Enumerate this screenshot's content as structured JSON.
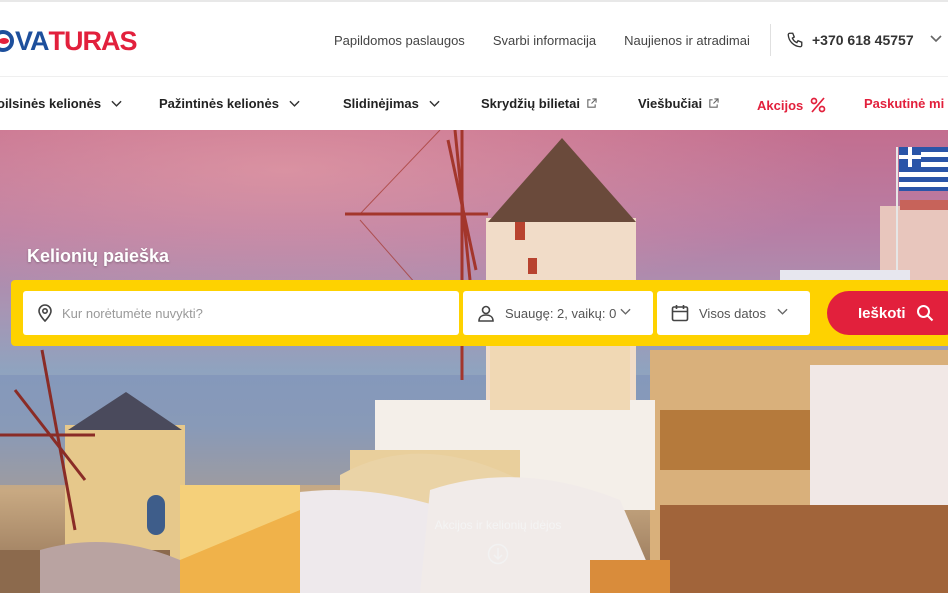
{
  "brand": {
    "logo_text_a": "VA",
    "logo_text_b": "TURAS"
  },
  "header": {
    "links": [
      "Papildomos paslaugos",
      "Svarbi informacija",
      "Naujienos ir atradimai"
    ],
    "phone": "+370 618 45757"
  },
  "nav": {
    "items": [
      {
        "label": "oilsinės kelionės",
        "kind": "dropdown"
      },
      {
        "label": "Pažintinės kelionės",
        "kind": "dropdown"
      },
      {
        "label": "Slidinėjimas",
        "kind": "dropdown"
      },
      {
        "label": "Skrydžių bilietai",
        "kind": "external"
      },
      {
        "label": "Viešbučiai",
        "kind": "external"
      },
      {
        "label": "Akcijos",
        "kind": "percent"
      },
      {
        "label": "Paskutinė mi",
        "kind": "plain"
      }
    ]
  },
  "hero": {
    "title": "Kelionių paieška",
    "destination_placeholder": "Kur norėtumėte nuvykti?",
    "travellers": "Suaugę: 2, vaikų: 0",
    "dates": "Visos datos",
    "search_label": "Ieškoti",
    "scroll_hint": "Akcijos ir kelionių idėjos"
  },
  "colors": {
    "brand_blue": "#1d4f9c",
    "brand_red": "#e2203c",
    "search_yellow": "#fed200"
  },
  "icons": [
    "phone-icon",
    "chevron-down-icon",
    "external-link-icon",
    "percent-icon",
    "location-pin-icon",
    "person-icon",
    "calendar-icon",
    "search-icon",
    "arrow-down-circle-icon"
  ]
}
